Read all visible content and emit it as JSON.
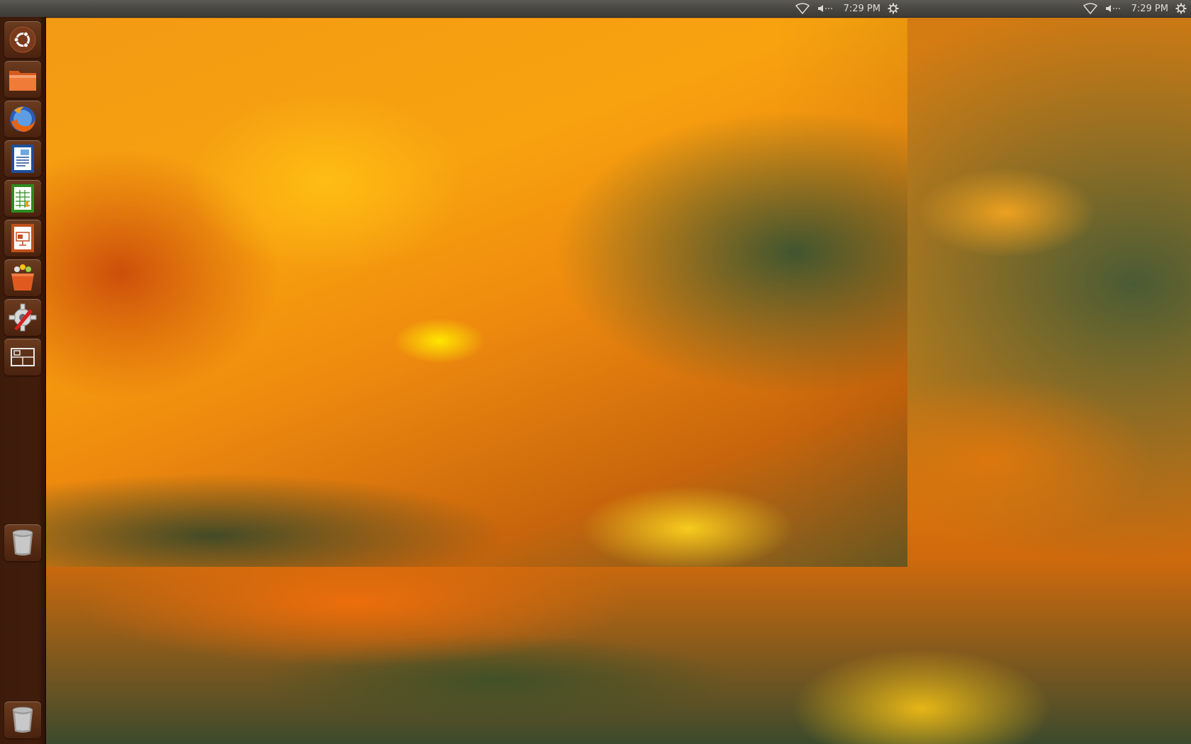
{
  "screens": [
    {
      "panel": {
        "clock": "7:29 PM",
        "indicators": [
          "wifi-icon",
          "volume-icon",
          "session-gear-icon"
        ]
      }
    },
    {
      "panel": {
        "clock": "7:29 PM",
        "indicators": [
          "wifi-icon",
          "volume-icon",
          "session-gear-icon"
        ]
      }
    }
  ],
  "launcher": {
    "items": [
      {
        "icon": "ubuntu-dash-icon"
      },
      {
        "icon": "home-folder-icon"
      },
      {
        "icon": "firefox-icon"
      },
      {
        "icon": "libreoffice-writer-icon"
      },
      {
        "icon": "libreoffice-calc-icon"
      },
      {
        "icon": "libreoffice-impress-icon"
      },
      {
        "icon": "software-center-icon"
      },
      {
        "icon": "system-settings-icon"
      },
      {
        "icon": "workspace-switcher-icon"
      },
      {
        "icon": "trash-icon"
      },
      {
        "icon": "trash-icon"
      }
    ]
  },
  "colors": {
    "panel": "#4a4944",
    "launcher": "#401c0b",
    "accent": "#f29a14"
  }
}
